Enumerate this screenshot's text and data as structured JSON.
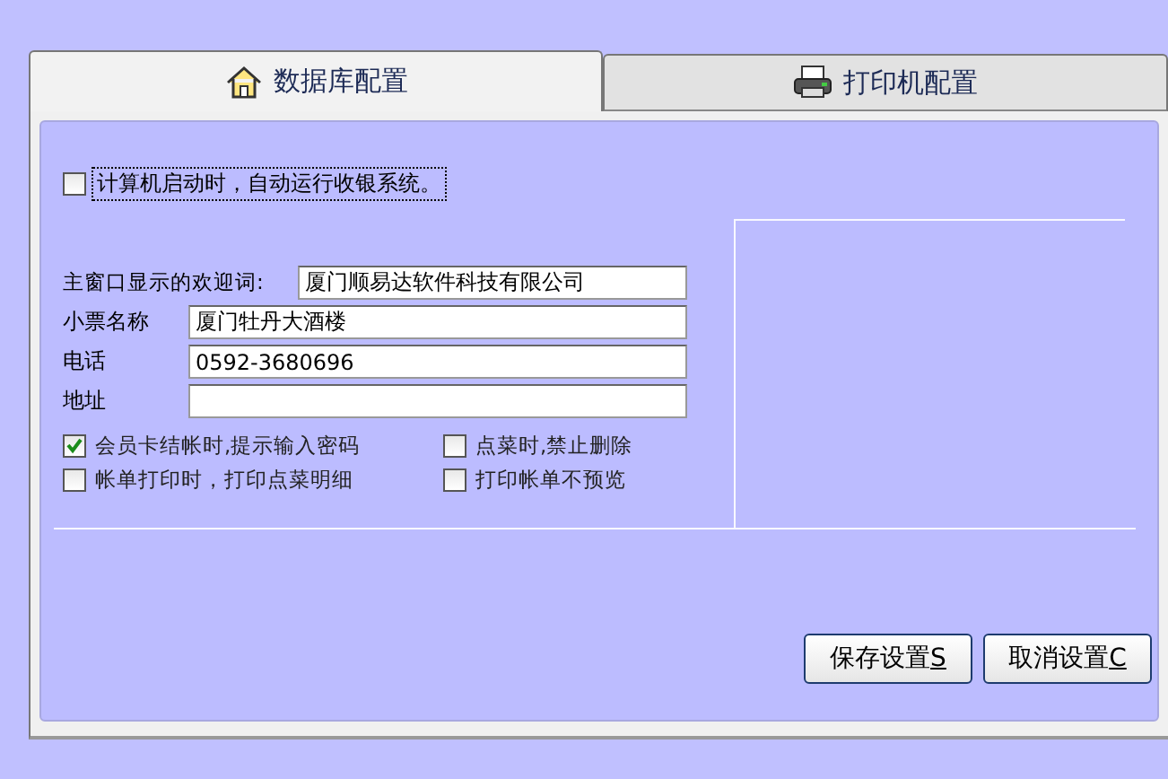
{
  "tabs": [
    {
      "label": "数据库配置",
      "kind": "house",
      "selected": true
    },
    {
      "label": "打印机配置",
      "kind": "printer",
      "selected": false
    }
  ],
  "autostart": {
    "label": "计算机启动时，自动运行收银系统。",
    "checked": false
  },
  "welcome": {
    "label": "主窗口显示的欢迎词:",
    "value": "厦门顺易达软件科技有限公司"
  },
  "fields": [
    {
      "label": "小票名称",
      "value": "厦门牡丹大酒楼"
    },
    {
      "label": "电话",
      "value": "0592-3680696"
    },
    {
      "label": "地址"
    }
  ],
  "options": [
    {
      "label": "会员卡结帐时,提示输入密码",
      "checked": true
    },
    {
      "label": "点菜时,禁止删除",
      "checked": false
    },
    {
      "label": "帐单打印时，打印点菜明细",
      "checked": false
    },
    {
      "label": "打印帐单不预览",
      "checked": false
    }
  ],
  "buttons": [
    {
      "label": "保存设置",
      "accel": "S"
    },
    {
      "label": "取消设置",
      "accel": "C"
    }
  ]
}
